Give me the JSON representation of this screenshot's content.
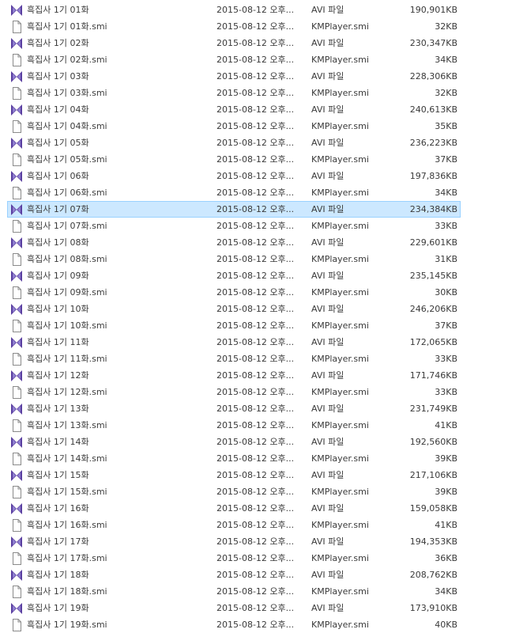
{
  "colors": {
    "selection_background": "#cce8ff",
    "selection_border": "#99d1ff",
    "text": "#3a3a3a",
    "avi_icon_primary": "#5a3fa0",
    "avi_icon_secondary": "#8f7fd0"
  },
  "files": [
    {
      "name": "흑집사 1기 01화",
      "date": "2015-08-12 오후...",
      "type": "AVI 파일",
      "size": "190,901KB",
      "icon": "avi-video-icon",
      "selected": false
    },
    {
      "name": "흑집사 1기 01화.smi",
      "date": "2015-08-12 오후...",
      "type": "KMPlayer.smi",
      "size": "32KB",
      "icon": "subtitle-file-icon",
      "selected": false
    },
    {
      "name": "흑집사 1기 02화",
      "date": "2015-08-12 오후...",
      "type": "AVI 파일",
      "size": "230,347KB",
      "icon": "avi-video-icon",
      "selected": false
    },
    {
      "name": "흑집사 1기 02화.smi",
      "date": "2015-08-12 오후...",
      "type": "KMPlayer.smi",
      "size": "34KB",
      "icon": "subtitle-file-icon",
      "selected": false
    },
    {
      "name": "흑집사 1기 03화",
      "date": "2015-08-12 오후...",
      "type": "AVI 파일",
      "size": "228,306KB",
      "icon": "avi-video-icon",
      "selected": false
    },
    {
      "name": "흑집사 1기 03화.smi",
      "date": "2015-08-12 오후...",
      "type": "KMPlayer.smi",
      "size": "32KB",
      "icon": "subtitle-file-icon",
      "selected": false
    },
    {
      "name": "흑집사 1기 04화",
      "date": "2015-08-12 오후...",
      "type": "AVI 파일",
      "size": "240,613KB",
      "icon": "avi-video-icon",
      "selected": false
    },
    {
      "name": "흑집사 1기 04화.smi",
      "date": "2015-08-12 오후...",
      "type": "KMPlayer.smi",
      "size": "35KB",
      "icon": "subtitle-file-icon",
      "selected": false
    },
    {
      "name": "흑집사 1기 05화",
      "date": "2015-08-12 오후...",
      "type": "AVI 파일",
      "size": "236,223KB",
      "icon": "avi-video-icon",
      "selected": false
    },
    {
      "name": "흑집사 1기 05화.smi",
      "date": "2015-08-12 오후...",
      "type": "KMPlayer.smi",
      "size": "37KB",
      "icon": "subtitle-file-icon",
      "selected": false
    },
    {
      "name": "흑집사 1기 06화",
      "date": "2015-08-12 오후...",
      "type": "AVI 파일",
      "size": "197,836KB",
      "icon": "avi-video-icon",
      "selected": false
    },
    {
      "name": "흑집사 1기 06화.smi",
      "date": "2015-08-12 오후...",
      "type": "KMPlayer.smi",
      "size": "34KB",
      "icon": "subtitle-file-icon",
      "selected": false
    },
    {
      "name": "흑집사 1기 07화",
      "date": "2015-08-12 오후...",
      "type": "AVI 파일",
      "size": "234,384KB",
      "icon": "avi-video-icon",
      "selected": true
    },
    {
      "name": "흑집사 1기 07화.smi",
      "date": "2015-08-12 오후...",
      "type": "KMPlayer.smi",
      "size": "33KB",
      "icon": "subtitle-file-icon",
      "selected": false
    },
    {
      "name": "흑집사 1기 08화",
      "date": "2015-08-12 오후...",
      "type": "AVI 파일",
      "size": "229,601KB",
      "icon": "avi-video-icon",
      "selected": false
    },
    {
      "name": "흑집사 1기 08화.smi",
      "date": "2015-08-12 오후...",
      "type": "KMPlayer.smi",
      "size": "31KB",
      "icon": "subtitle-file-icon",
      "selected": false
    },
    {
      "name": "흑집사 1기 09화",
      "date": "2015-08-12 오후...",
      "type": "AVI 파일",
      "size": "235,145KB",
      "icon": "avi-video-icon",
      "selected": false
    },
    {
      "name": "흑집사 1기 09화.smi",
      "date": "2015-08-12 오후...",
      "type": "KMPlayer.smi",
      "size": "30KB",
      "icon": "subtitle-file-icon",
      "selected": false
    },
    {
      "name": "흑집사 1기 10화",
      "date": "2015-08-12 오후...",
      "type": "AVI 파일",
      "size": "246,206KB",
      "icon": "avi-video-icon",
      "selected": false
    },
    {
      "name": "흑집사 1기 10화.smi",
      "date": "2015-08-12 오후...",
      "type": "KMPlayer.smi",
      "size": "37KB",
      "icon": "subtitle-file-icon",
      "selected": false
    },
    {
      "name": "흑집사 1기 11화",
      "date": "2015-08-12 오후...",
      "type": "AVI 파일",
      "size": "172,065KB",
      "icon": "avi-video-icon",
      "selected": false
    },
    {
      "name": "흑집사 1기 11화.smi",
      "date": "2015-08-12 오후...",
      "type": "KMPlayer.smi",
      "size": "33KB",
      "icon": "subtitle-file-icon",
      "selected": false
    },
    {
      "name": "흑집사 1기 12화",
      "date": "2015-08-12 오후...",
      "type": "AVI 파일",
      "size": "171,746KB",
      "icon": "avi-video-icon",
      "selected": false
    },
    {
      "name": "흑집사 1기 12화.smi",
      "date": "2015-08-12 오후...",
      "type": "KMPlayer.smi",
      "size": "33KB",
      "icon": "subtitle-file-icon",
      "selected": false
    },
    {
      "name": "흑집사 1기 13화",
      "date": "2015-08-12 오후...",
      "type": "AVI 파일",
      "size": "231,749KB",
      "icon": "avi-video-icon",
      "selected": false
    },
    {
      "name": "흑집사 1기 13화.smi",
      "date": "2015-08-12 오후...",
      "type": "KMPlayer.smi",
      "size": "41KB",
      "icon": "subtitle-file-icon",
      "selected": false
    },
    {
      "name": "흑집사 1기 14화",
      "date": "2015-08-12 오후...",
      "type": "AVI 파일",
      "size": "192,560KB",
      "icon": "avi-video-icon",
      "selected": false
    },
    {
      "name": "흑집사 1기 14화.smi",
      "date": "2015-08-12 오후...",
      "type": "KMPlayer.smi",
      "size": "39KB",
      "icon": "subtitle-file-icon",
      "selected": false
    },
    {
      "name": "흑집사 1기 15화",
      "date": "2015-08-12 오후...",
      "type": "AVI 파일",
      "size": "217,106KB",
      "icon": "avi-video-icon",
      "selected": false
    },
    {
      "name": "흑집사 1기 15화.smi",
      "date": "2015-08-12 오후...",
      "type": "KMPlayer.smi",
      "size": "39KB",
      "icon": "subtitle-file-icon",
      "selected": false
    },
    {
      "name": "흑집사 1기 16화",
      "date": "2015-08-12 오후...",
      "type": "AVI 파일",
      "size": "159,058KB",
      "icon": "avi-video-icon",
      "selected": false
    },
    {
      "name": "흑집사 1기 16화.smi",
      "date": "2015-08-12 오후...",
      "type": "KMPlayer.smi",
      "size": "41KB",
      "icon": "subtitle-file-icon",
      "selected": false
    },
    {
      "name": "흑집사 1기 17화",
      "date": "2015-08-12 오후...",
      "type": "AVI 파일",
      "size": "194,353KB",
      "icon": "avi-video-icon",
      "selected": false
    },
    {
      "name": "흑집사 1기 17화.smi",
      "date": "2015-08-12 오후...",
      "type": "KMPlayer.smi",
      "size": "36KB",
      "icon": "subtitle-file-icon",
      "selected": false
    },
    {
      "name": "흑집사 1기 18화",
      "date": "2015-08-12 오후...",
      "type": "AVI 파일",
      "size": "208,762KB",
      "icon": "avi-video-icon",
      "selected": false
    },
    {
      "name": "흑집사 1기 18화.smi",
      "date": "2015-08-12 오후...",
      "type": "KMPlayer.smi",
      "size": "34KB",
      "icon": "subtitle-file-icon",
      "selected": false
    },
    {
      "name": "흑집사 1기 19화",
      "date": "2015-08-12 오후...",
      "type": "AVI 파일",
      "size": "173,910KB",
      "icon": "avi-video-icon",
      "selected": false
    },
    {
      "name": "흑집사 1기 19화.smi",
      "date": "2015-08-12 오후...",
      "type": "KMPlayer.smi",
      "size": "40KB",
      "icon": "subtitle-file-icon",
      "selected": false
    }
  ]
}
